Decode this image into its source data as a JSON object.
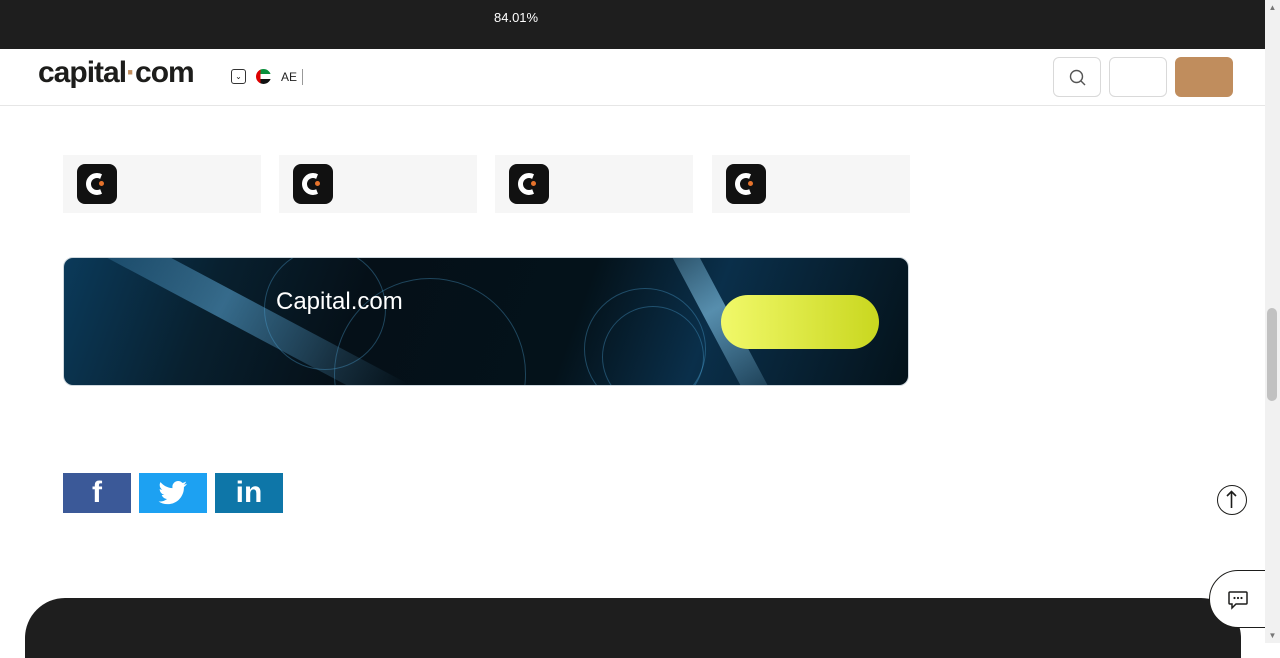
{
  "topbar": {
    "percent": "84.01%"
  },
  "header": {
    "logo_text": "capital",
    "logo_dot": "·",
    "logo_suffix": "com",
    "language_code": "AE",
    "signup_color": "#c08d5d"
  },
  "app_cards": [
    {
      "icon": "capital-app-icon"
    },
    {
      "icon": "capital-app-icon"
    },
    {
      "icon": "capital-app-icon"
    },
    {
      "icon": "capital-app-icon"
    }
  ],
  "banner": {
    "brand": "Capital.com",
    "cta_color": "#e6f04a"
  },
  "share": {
    "facebook_glyph": "f",
    "linkedin_glyph": "in"
  },
  "colors": {
    "accent": "#c08d5d",
    "dark": "#1e1e1e",
    "facebook": "#3b5998",
    "twitter": "#1da1f2",
    "linkedin": "#0e76a8"
  }
}
